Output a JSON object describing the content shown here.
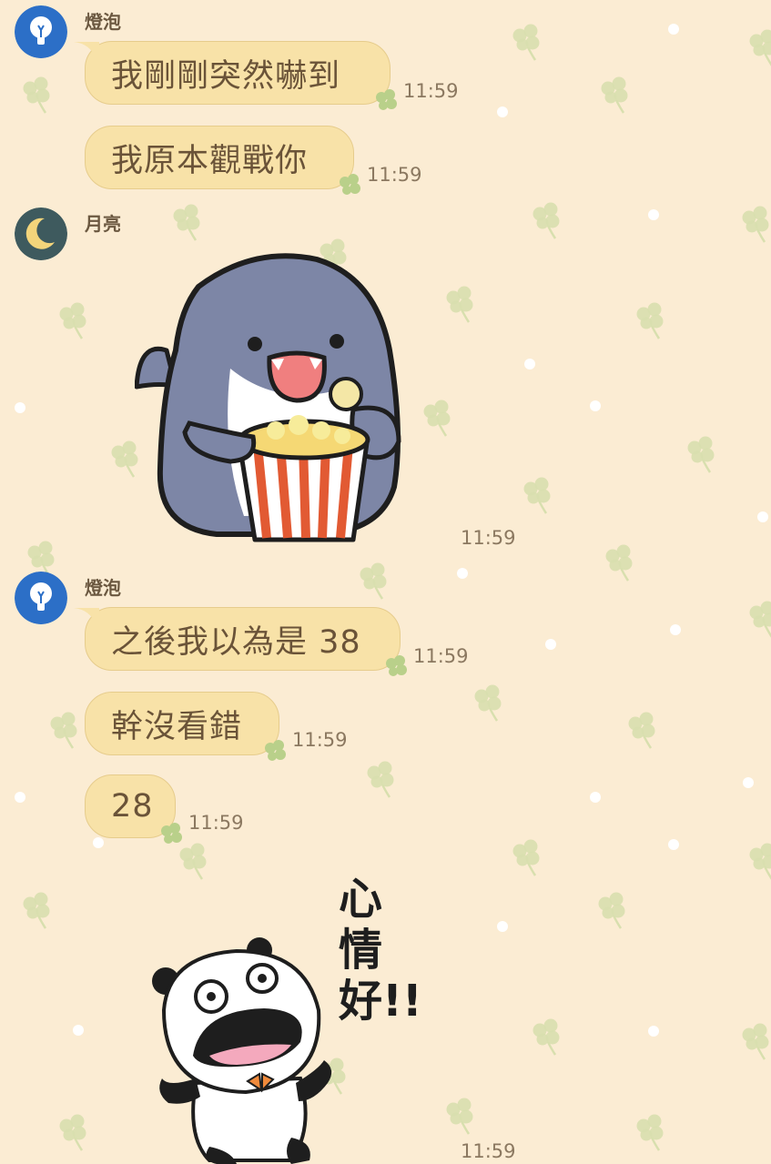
{
  "chat": {
    "messages": [
      {
        "sender": "燈泡",
        "avatar_icon": "lightbulb-icon",
        "text": "我剛剛突然嚇到",
        "time": "11:59"
      },
      {
        "sender": "燈泡",
        "text": "我原本觀戰你",
        "time": "11:59"
      },
      {
        "sender": "月亮",
        "avatar_icon": "crescent-moon-icon",
        "sticker": "shark-eating-popcorn-sticker",
        "time": "11:59"
      },
      {
        "sender": "燈泡",
        "avatar_icon": "lightbulb-icon",
        "text": "之後我以為是 38",
        "time": "11:59"
      },
      {
        "sender": "燈泡",
        "text": "幹沒看錯",
        "time": "11:59"
      },
      {
        "sender": "燈泡",
        "text": "28",
        "time": "11:59"
      },
      {
        "sender": "燈泡",
        "sticker": "panda-surprised-sticker",
        "sticker_text": "心情好!!",
        "time": "11:59"
      }
    ]
  },
  "colors": {
    "background": "#fbecd3",
    "bubble": "#f8e2a8",
    "bubble_border": "#e6cc8c",
    "text": "#6a5338",
    "time": "#8b7860"
  }
}
